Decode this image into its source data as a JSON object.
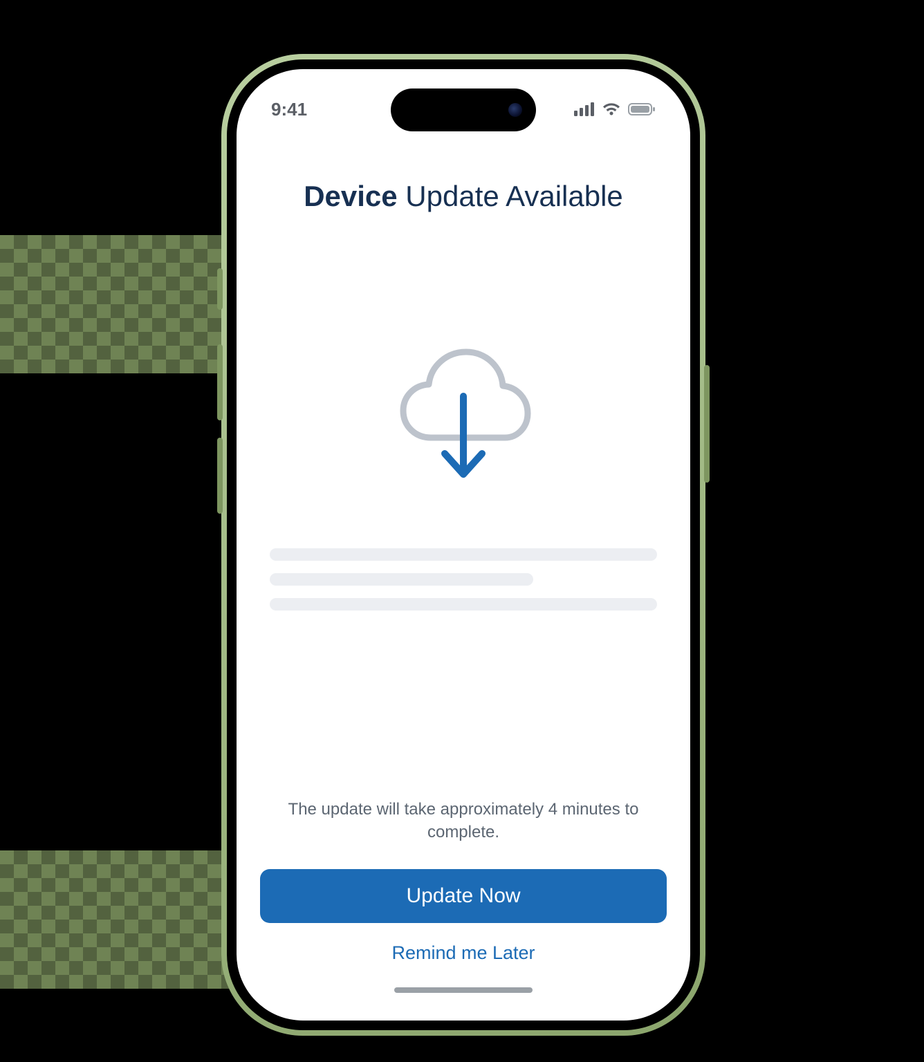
{
  "statusBar": {
    "time": "9:41"
  },
  "title": {
    "bold": "Device",
    "rest": " Update Available"
  },
  "estimate": "The update will take approximately 4 minutes to complete.",
  "buttons": {
    "primary": "Update Now",
    "secondary": "Remind me Later"
  },
  "colors": {
    "accent": "#1C6BB5",
    "titleText": "#173052",
    "placeholder": "#ECEEF2"
  }
}
